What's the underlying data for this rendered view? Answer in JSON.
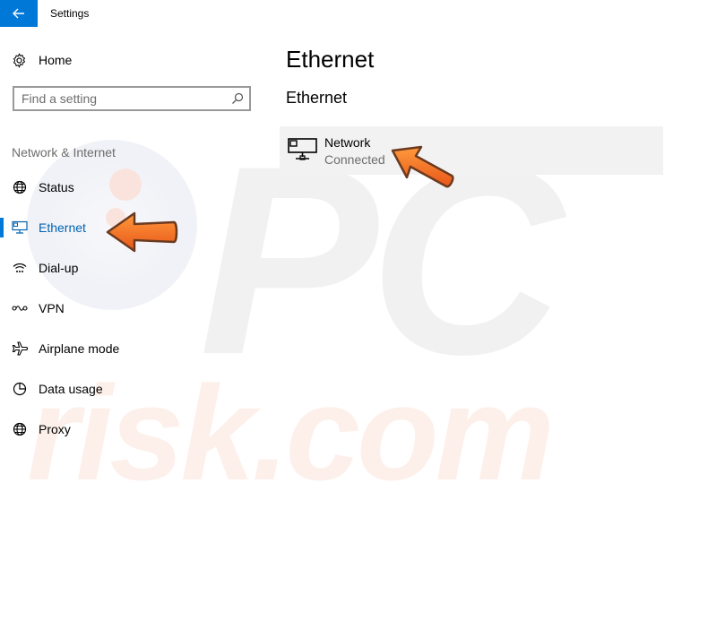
{
  "titlebar": {
    "title": "Settings"
  },
  "sidebar": {
    "home_label": "Home",
    "search_placeholder": "Find a setting",
    "section_heading": "Network & Internet",
    "items": [
      {
        "label": "Status",
        "icon": "globe-icon"
      },
      {
        "label": "Ethernet",
        "icon": "ethernet-icon",
        "selected": true
      },
      {
        "label": "Dial-up",
        "icon": "dialup-icon"
      },
      {
        "label": "VPN",
        "icon": "vpn-icon"
      },
      {
        "label": "Airplane mode",
        "icon": "airplane-icon"
      },
      {
        "label": "Data usage",
        "icon": "data-usage-icon"
      },
      {
        "label": "Proxy",
        "icon": "globe-icon"
      }
    ]
  },
  "main": {
    "page_title": "Ethernet",
    "section_title": "Ethernet",
    "network": {
      "name": "Network",
      "status": "Connected"
    }
  },
  "colors": {
    "accent": "#0078d7",
    "selected_text": "#0063b1",
    "arrow": "#f26f21"
  }
}
